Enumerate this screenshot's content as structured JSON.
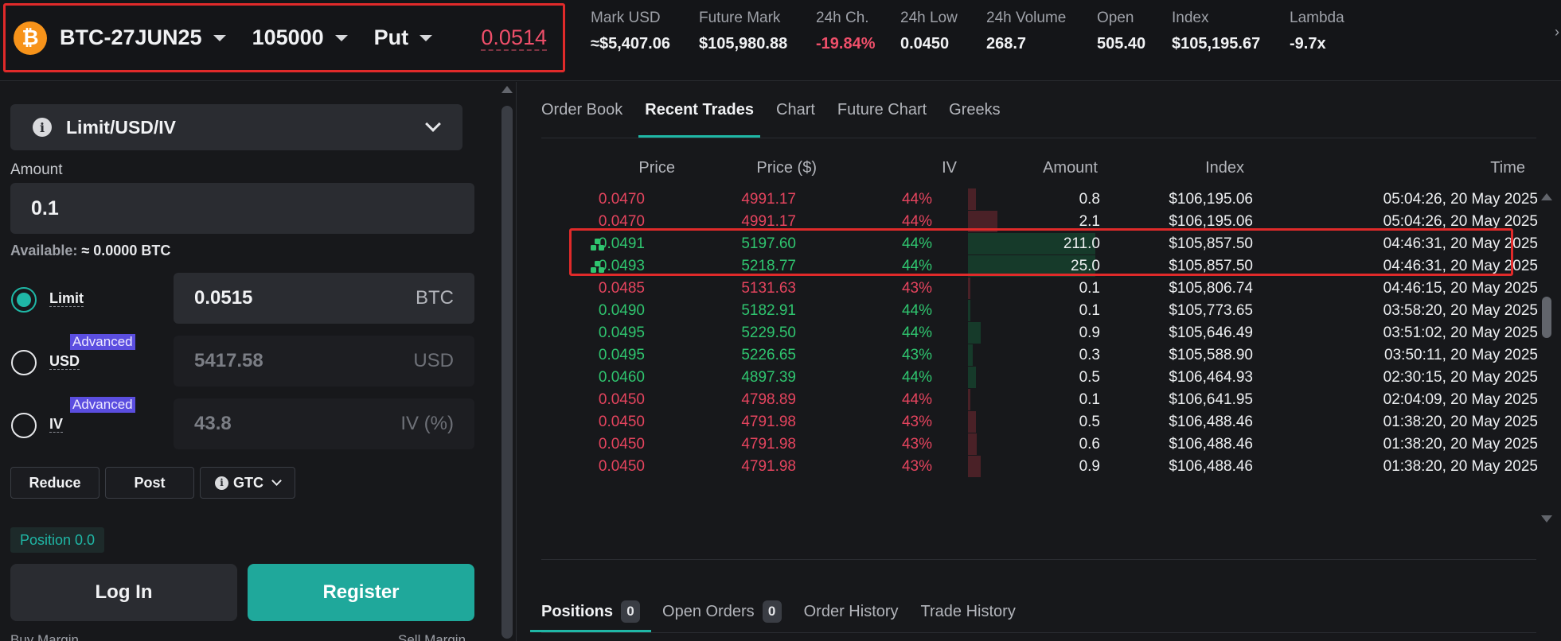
{
  "header": {
    "instrument": "BTC-27JUN25",
    "strike": "105000",
    "option_type": "Put",
    "price": "0.0514",
    "stats": [
      {
        "label": "Mark USD",
        "value": "≈$5,407.06",
        "tone": "neutral"
      },
      {
        "label": "Future Mark",
        "value": "$105,980.88",
        "tone": "neutral"
      },
      {
        "label": "24h Ch.",
        "value": "-19.84%",
        "tone": "negative"
      },
      {
        "label": "24h Low",
        "value": "0.0450",
        "tone": "neutral"
      },
      {
        "label": "24h Volume",
        "value": "268.7",
        "tone": "neutral"
      },
      {
        "label": "Open",
        "value": "505.40",
        "tone": "neutral"
      },
      {
        "label": "Index",
        "value": "$105,195.67",
        "tone": "neutral"
      },
      {
        "label": "Lambda",
        "value": "-9.7x",
        "tone": "neutral"
      }
    ]
  },
  "order_form": {
    "order_type": "Limit/USD/IV",
    "amount_label": "Amount",
    "amount_value": "0.1",
    "available_label": "Available:",
    "available_value": "≈ 0.0000 BTC",
    "modes": [
      {
        "label": "Limit",
        "value": "0.0515",
        "unit": "BTC",
        "selected": true,
        "badge": ""
      },
      {
        "label": "USD",
        "value": "5417.58",
        "unit": "USD",
        "selected": false,
        "badge": "Advanced"
      },
      {
        "label": "IV",
        "value": "43.8",
        "unit": "IV (%)",
        "selected": false,
        "badge": "Advanced"
      }
    ],
    "reduce_label": "Reduce",
    "post_label": "Post",
    "tif_label": "GTC",
    "position_label": "Position 0.0",
    "login_label": "Log In",
    "register_label": "Register",
    "buy_margin_label": "Buy Margin",
    "sell_margin_label": "Sell Margin"
  },
  "market_tabs": [
    {
      "label": "Order Book",
      "active": false
    },
    {
      "label": "Recent Trades",
      "active": true
    },
    {
      "label": "Chart",
      "active": false
    },
    {
      "label": "Future Chart",
      "active": false
    },
    {
      "label": "Greeks",
      "active": false
    }
  ],
  "trades_table": {
    "columns": [
      "Price",
      "Price ($)",
      "IV",
      "Amount",
      "Index",
      "Time"
    ],
    "rows": [
      {
        "price": "0.0470",
        "usd": "4991.17",
        "iv": "44%",
        "amount": "0.8",
        "index": "$106,195.06",
        "time": "05:04:26, 20 May 2025",
        "side": "sell",
        "block": false,
        "bar": 0.06
      },
      {
        "price": "0.0470",
        "usd": "4991.17",
        "iv": "44%",
        "amount": "2.1",
        "index": "$106,195.06",
        "time": "05:04:26, 20 May 2025",
        "side": "sell",
        "block": false,
        "bar": 0.23
      },
      {
        "price": "0.0491",
        "usd": "5197.60",
        "iv": "44%",
        "amount": "211.0",
        "index": "$105,857.50",
        "time": "04:46:31, 20 May 2025",
        "side": "buy",
        "block": true,
        "bar": 1.0
      },
      {
        "price": "0.0493",
        "usd": "5218.77",
        "iv": "44%",
        "amount": "25.0",
        "index": "$105,857.50",
        "time": "04:46:31, 20 May 2025",
        "side": "buy",
        "block": true,
        "bar": 1.0
      },
      {
        "price": "0.0485",
        "usd": "5131.63",
        "iv": "43%",
        "amount": "0.1",
        "index": "$105,806.74",
        "time": "04:46:15, 20 May 2025",
        "side": "sell",
        "block": false,
        "bar": 0.015
      },
      {
        "price": "0.0490",
        "usd": "5182.91",
        "iv": "44%",
        "amount": "0.1",
        "index": "$105,773.65",
        "time": "03:58:20, 20 May 2025",
        "side": "buy",
        "block": false,
        "bar": 0.015
      },
      {
        "price": "0.0495",
        "usd": "5229.50",
        "iv": "44%",
        "amount": "0.9",
        "index": "$105,646.49",
        "time": "03:51:02, 20 May 2025",
        "side": "buy",
        "block": false,
        "bar": 0.1
      },
      {
        "price": "0.0495",
        "usd": "5226.65",
        "iv": "43%",
        "amount": "0.3",
        "index": "$105,588.90",
        "time": "03:50:11, 20 May 2025",
        "side": "buy",
        "block": false,
        "bar": 0.035
      },
      {
        "price": "0.0460",
        "usd": "4897.39",
        "iv": "44%",
        "amount": "0.5",
        "index": "$106,464.93",
        "time": "02:30:15, 20 May 2025",
        "side": "buy",
        "block": false,
        "bar": 0.06
      },
      {
        "price": "0.0450",
        "usd": "4798.89",
        "iv": "44%",
        "amount": "0.1",
        "index": "$106,641.95",
        "time": "02:04:09, 20 May 2025",
        "side": "sell",
        "block": false,
        "bar": 0.015
      },
      {
        "price": "0.0450",
        "usd": "4791.98",
        "iv": "43%",
        "amount": "0.5",
        "index": "$106,488.46",
        "time": "01:38:20, 20 May 2025",
        "side": "sell",
        "block": false,
        "bar": 0.06
      },
      {
        "price": "0.0450",
        "usd": "4791.98",
        "iv": "43%",
        "amount": "0.6",
        "index": "$106,488.46",
        "time": "01:38:20, 20 May 2025",
        "side": "sell",
        "block": false,
        "bar": 0.07
      },
      {
        "price": "0.0450",
        "usd": "4791.98",
        "iv": "43%",
        "amount": "0.9",
        "index": "$106,488.46",
        "time": "01:38:20, 20 May 2025",
        "side": "sell",
        "block": false,
        "bar": 0.1
      }
    ]
  },
  "bottom_tabs": [
    {
      "label": "Positions",
      "count": "0",
      "active": true
    },
    {
      "label": "Open Orders",
      "count": "0",
      "active": false
    },
    {
      "label": "Order History",
      "count": "",
      "active": false
    },
    {
      "label": "Trade History",
      "count": "",
      "active": false
    }
  ],
  "colors": {
    "accent": "#1fb7a6",
    "sell": "#e5445e",
    "buy": "#2fc56f",
    "highlight_outline": "#e02a2a",
    "btc": "#f7931a"
  },
  "icons": {
    "btc": "₿",
    "block_trade": "block-trade-icon",
    "info": "info-icon",
    "chevron": "chevron-down-icon"
  }
}
